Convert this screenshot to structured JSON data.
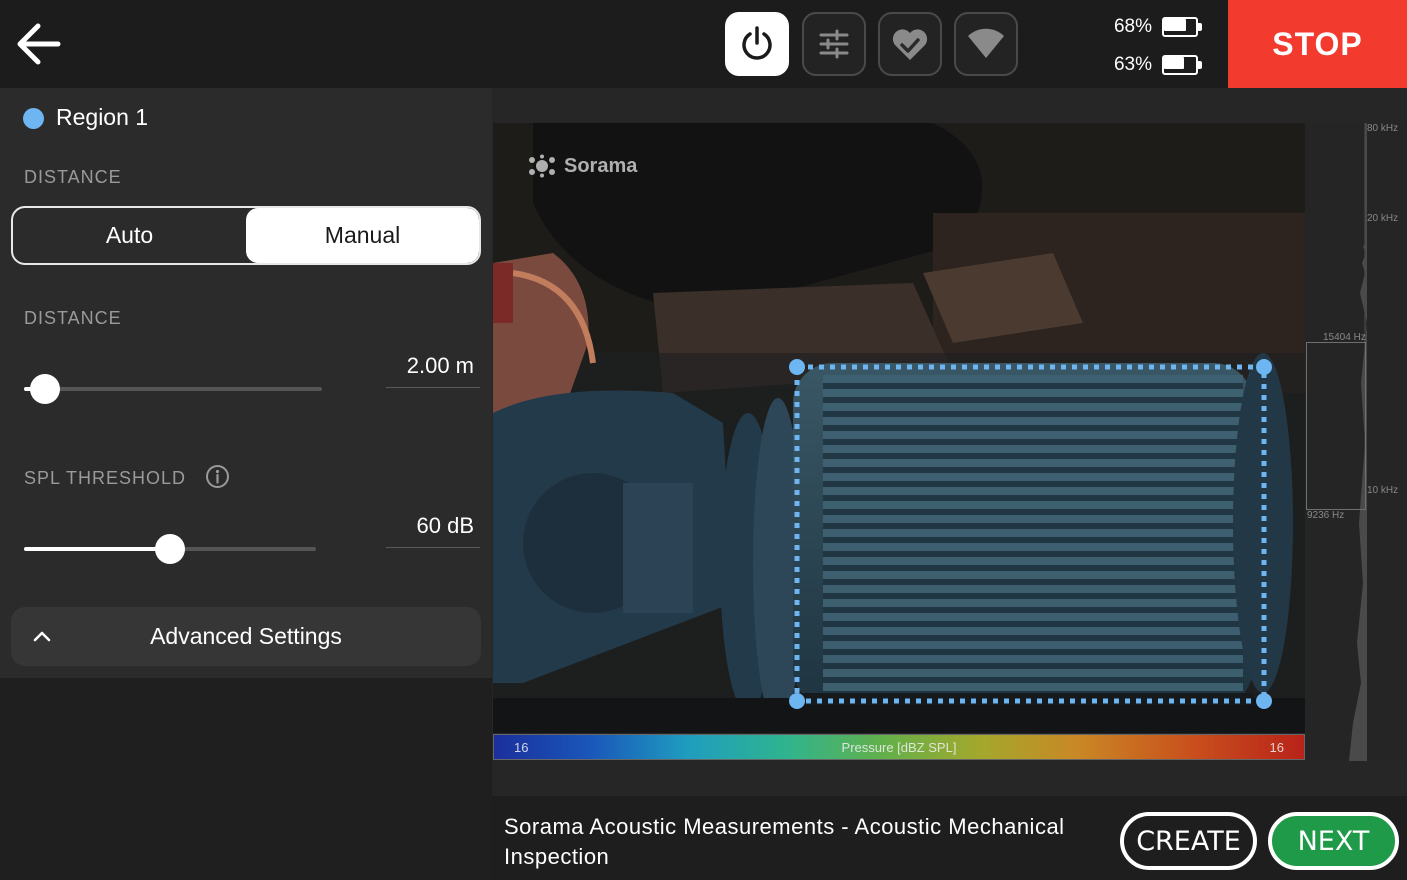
{
  "header": {
    "back_icon": "arrow-left-icon",
    "tools": [
      {
        "icon": "power-icon",
        "active": true
      },
      {
        "icon": "sliders-icon",
        "active": false
      },
      {
        "icon": "heart-icon",
        "active": false
      },
      {
        "icon": "wifi-icon",
        "active": false
      }
    ],
    "batteries": [
      {
        "percent_label": "68%",
        "level": 0.68
      },
      {
        "percent_label": "63%",
        "level": 0.63
      }
    ],
    "stop_label": "STOP",
    "stop_color": "#f23a2f"
  },
  "panel": {
    "region_label": "Region 1",
    "region_color": "#6db6f2",
    "distance_mode_label": "DISTANCE",
    "mode_options": [
      "Auto",
      "Manual"
    ],
    "mode_selected": "Manual",
    "distance_label": "DISTANCE",
    "distance_value": "2.00 m",
    "distance_slider_fraction": 0.07,
    "spl_label": "SPL THRESHOLD",
    "spl_value": "60 dB",
    "spl_slider_fraction": 0.5,
    "advanced_label": "Advanced Settings"
  },
  "viewer": {
    "brand": "Sorama",
    "colorbar_min": "16",
    "colorbar_max": "16",
    "colorbar_label": "Pressure [dBZ SPL]",
    "spectrum_labels": {
      "top": "80 kHz",
      "mid_high": "20 kHz",
      "marker_high": "15404 Hz",
      "mid_low": "10 kHz",
      "marker_low": "9236 Hz"
    },
    "selection_color": "#6db6f2"
  },
  "footer": {
    "title": "Sorama Acoustic Measurements - Acoustic Mechanical Inspection",
    "create_label": "CREATE",
    "next_label": "NEXT",
    "next_color": "#1e9a48"
  }
}
